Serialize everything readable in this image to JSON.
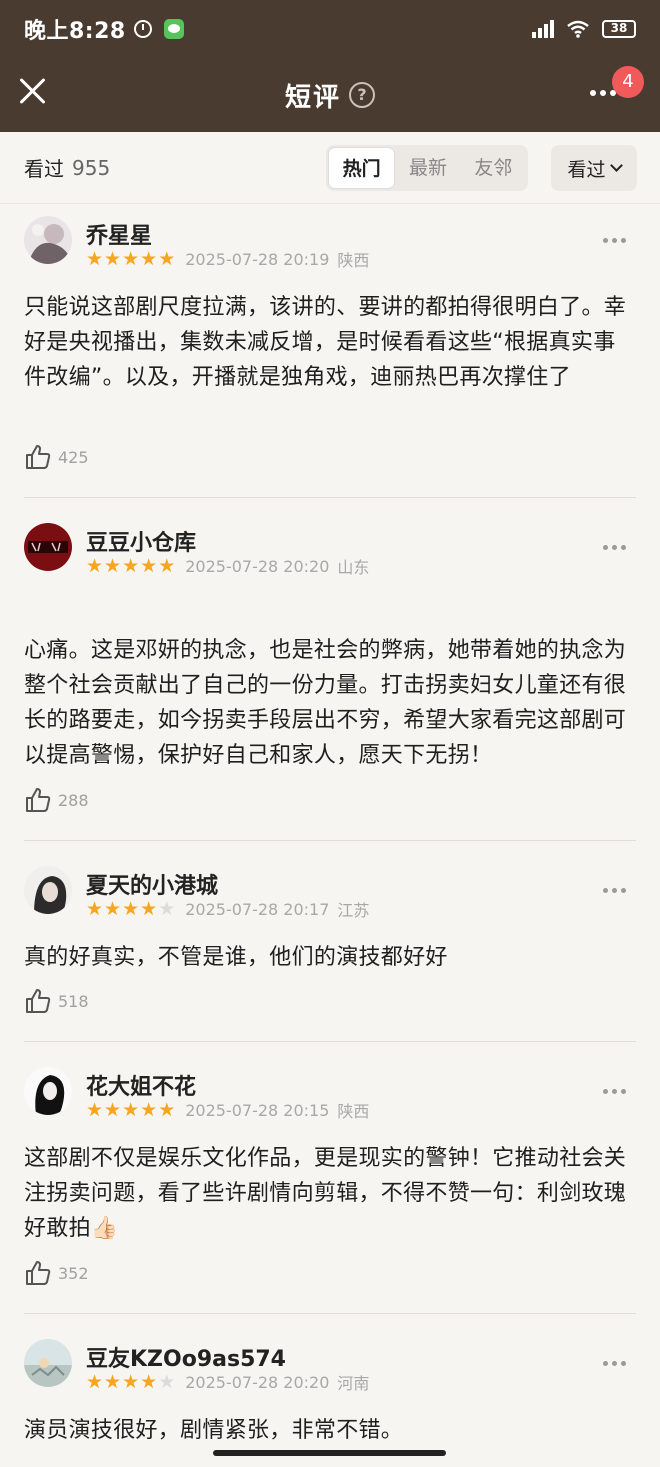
{
  "status": {
    "time": "晚上8:28",
    "battery": "38"
  },
  "nav": {
    "title": "短评",
    "help": "?",
    "badge": "4"
  },
  "filter": {
    "seen_label": "看过",
    "seen_count": "955",
    "tabs": [
      "热门",
      "最新",
      "友邻"
    ],
    "active_tab": "热门",
    "dropdown_label": "看过"
  },
  "reviews": [
    {
      "username": "乔星星",
      "rating": 5,
      "datetime": "2025-07-28 20:19",
      "region": "陕西",
      "content": "只能说这部剧尺度拉满，该讲的、要讲的都拍得很明白了。幸好是央视播出，集数未减反增，是时候看看这些“根据真实事件改编”。以及，开播就是独角戏，迪丽热巴再次撑住了",
      "likes": "425"
    },
    {
      "username": "豆豆小仓库",
      "rating": 5,
      "datetime": "2025-07-28 20:20",
      "region": "山东",
      "content": "心痛。这是邓妍的执念，也是社会的弊病，她带着她的执念为整个社会贡献出了自己的一份力量。打击拐卖妇女儿童还有很长的路要走，如今拐卖手段层出不穷，希望大家看完这部剧可以提高警惕，保护好自己和家人，愿天下无拐！",
      "likes": "288"
    },
    {
      "username": "夏天的小港城",
      "rating": 4,
      "datetime": "2025-07-28 20:17",
      "region": "江苏",
      "content": "真的好真实，不管是谁，他们的演技都好好",
      "likes": "518"
    },
    {
      "username": "花大姐不花",
      "rating": 5,
      "datetime": "2025-07-28 20:15",
      "region": "陕西",
      "content": "这部剧不仅是娱乐文化作品，更是现实的警钟！它推动社会关注拐卖问题，看了些许剧情向剪辑，不得不赞一句：利剑玫瑰好敢拍👍🏻",
      "likes": "352"
    },
    {
      "username": "豆友KZOo9as574",
      "rating": 4,
      "datetime": "2025-07-28 20:20",
      "region": "河南",
      "content": "演员演技很好，剧情紧张，非常不错。",
      "likes": ""
    }
  ]
}
